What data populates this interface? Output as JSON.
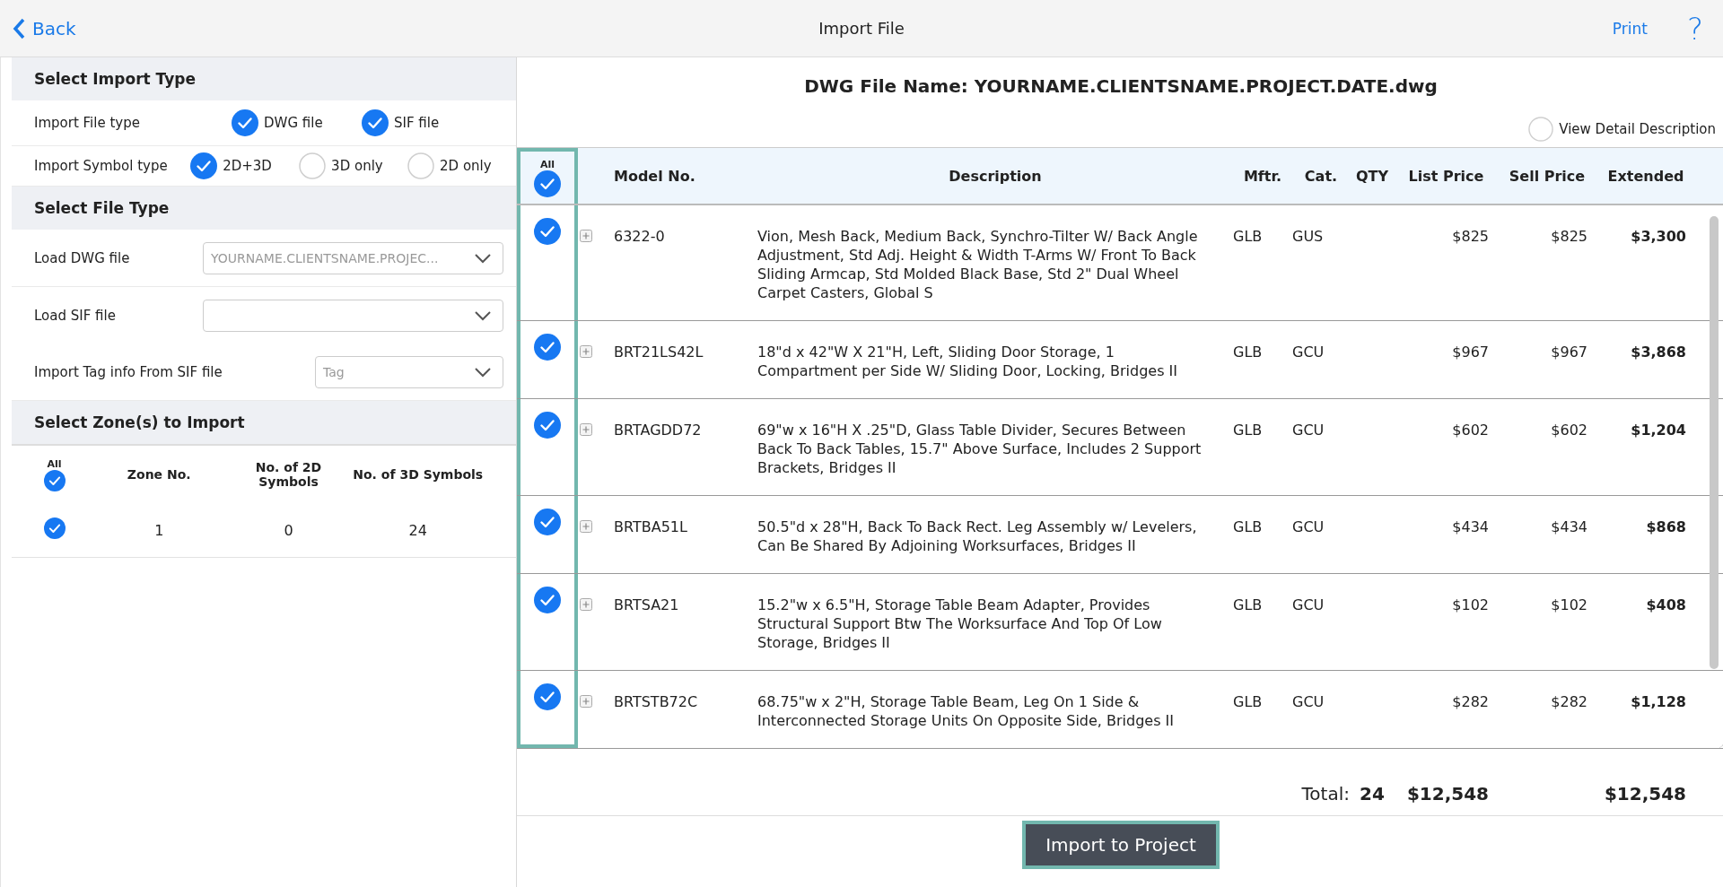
{
  "header": {
    "back": "Back",
    "title": "Import File",
    "print": "Print",
    "help": "?"
  },
  "import_type": {
    "title": "Select Import Type",
    "rows": [
      {
        "label": "Import File type",
        "options": [
          {
            "label": "DWG file",
            "checked": true
          },
          {
            "label": "SIF file",
            "checked": true
          }
        ]
      },
      {
        "label": "Import Symbol type",
        "options": [
          {
            "label": "2D+3D",
            "selected": true
          },
          {
            "label": "3D only",
            "selected": false
          },
          {
            "label": "2D only",
            "selected": false
          }
        ]
      }
    ]
  },
  "file_type": {
    "title": "Select File Type",
    "fields": [
      {
        "label": "Load DWG file",
        "value": "YOURNAME.CLIENTSNAME.PROJEC..."
      },
      {
        "label": "Load SIF file"
      },
      {
        "label": "Import Tag info From SIF file",
        "placeholder": "Tag"
      }
    ]
  },
  "zones": {
    "title": "Select Zone(s) to Import",
    "all_label": "All",
    "all_checked": true,
    "columns": [
      "Zone No.",
      "No. of 2D Symbols",
      "No. of 3D Symbols"
    ],
    "rows": [
      {
        "checked": true,
        "zone": "1",
        "symbols_2d": "0",
        "symbols_3d": "24"
      }
    ]
  },
  "file_name": "DWG File Name: YOURNAME.CLIENTSNAME.PROJECT.DATE.dwg",
  "view_detail": {
    "label": "View Detail Description",
    "checked": false
  },
  "table": {
    "all_label": "All",
    "all_checked": true,
    "columns": [
      "Model No.",
      "Description",
      "Mftr.",
      "Cat.",
      "QTY",
      "List Price",
      "Sell Price",
      "Extended"
    ],
    "rows": [
      {
        "checked": true,
        "model": "6322-0",
        "description": "Vion, Mesh Back, Medium Back, Synchro-Tilter W/ Back Angle Adjustment, Std Adj. Height & Width T-Arms W/ Front To Back Sliding Armcap, Std Molded Black Base, Std 2\" Dual Wheel Carpet Casters, Global S",
        "mftr": "GLB",
        "cat": "GUS",
        "list_price": "$825",
        "sell_price": "$825",
        "extended": "$3,300"
      },
      {
        "checked": true,
        "model": "BRT21LS42L",
        "description": "18\"d x 42\"W X 21\"H, Left, Sliding Door Storage, 1 Compartment per Side W/ Sliding Door, Locking, Bridges II",
        "mftr": "GLB",
        "cat": "GCU",
        "list_price": "$967",
        "sell_price": "$967",
        "extended": "$3,868"
      },
      {
        "checked": true,
        "model": "BRTAGDD72",
        "description": "69\"w x 16\"H X .25\"D, Glass Table Divider, Secures Between Back To Back Tables, 15.7\" Above Surface, Includes 2 Support Brackets, Bridges II",
        "mftr": "GLB",
        "cat": "GCU",
        "list_price": "$602",
        "sell_price": "$602",
        "extended": "$1,204"
      },
      {
        "checked": true,
        "model": "BRTBA51L",
        "description": "50.5\"d x 28\"H, Back To Back Rect. Leg Assembly w/ Levelers, Can Be Shared By Adjoining Worksurfaces, Bridges II",
        "mftr": "GLB",
        "cat": "GCU",
        "list_price": "$434",
        "sell_price": "$434",
        "extended": "$868"
      },
      {
        "checked": true,
        "model": "BRTSA21",
        "description": "15.2\"w x 6.5\"H, Storage Table Beam Adapter, Provides Structural Support Btw The Worksurface And Top Of Low Storage, Bridges II",
        "mftr": "GLB",
        "cat": "GCU",
        "list_price": "$102",
        "sell_price": "$102",
        "extended": "$408"
      },
      {
        "checked": true,
        "model": "BRTSTB72C",
        "description": "68.75\"w x 2\"H, Storage Table Beam, Leg On 1 Side & Interconnected Storage Units On Opposite Side, Bridges II",
        "mftr": "GLB",
        "cat": "GCU",
        "list_price": "$282",
        "sell_price": "$282",
        "extended": "$1,128"
      }
    ]
  },
  "totals": {
    "label": "Total:",
    "qty": "24",
    "list_price": "$12,548",
    "extended": "$12,548"
  },
  "import_button": "Import to Project"
}
